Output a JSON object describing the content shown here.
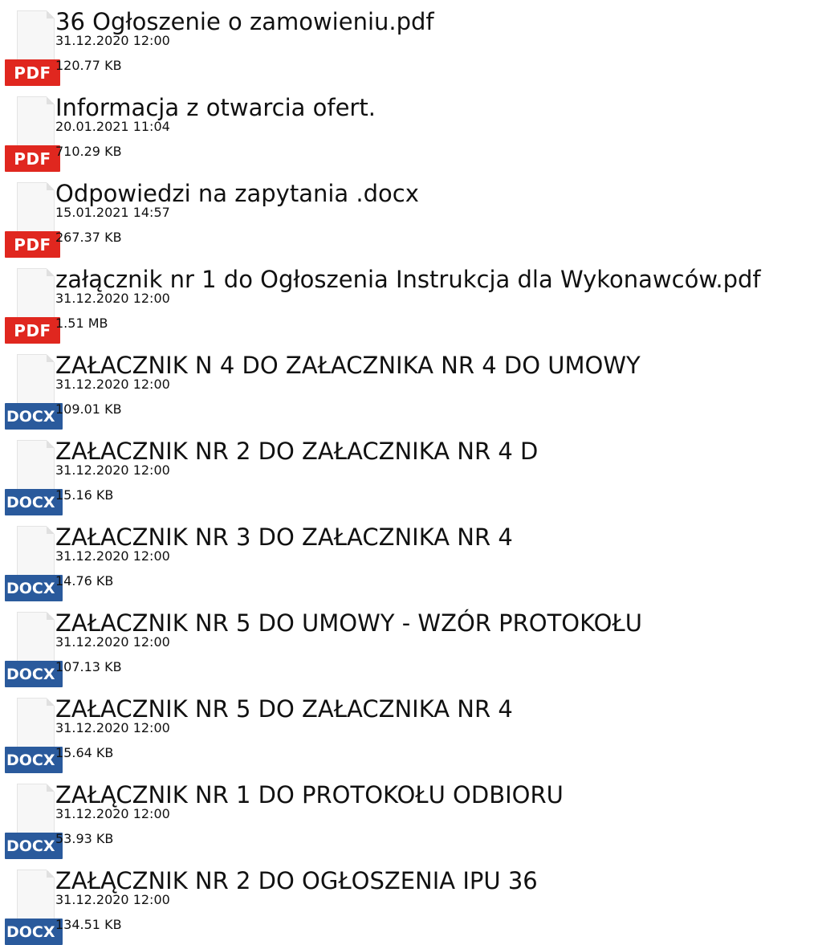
{
  "colors": {
    "pdf_badge": "#e0271f",
    "docx_badge": "#2a5a9c"
  },
  "files": [
    {
      "name": "36 Ogłoszenie o zamowieniu.pdf",
      "date": "31.12.2020 12:00",
      "size": "120.77 KB",
      "type": "PDF",
      "icon": "pdf-file-icon"
    },
    {
      "name": "Informacja z otwarcia ofert.",
      "date": "20.01.2021 11:04",
      "size": "710.29 KB",
      "type": "PDF",
      "icon": "pdf-file-icon"
    },
    {
      "name": "Odpowiedzi na zapytania .docx",
      "date": "15.01.2021 14:57",
      "size": "267.37 KB",
      "type": "PDF",
      "icon": "pdf-file-icon"
    },
    {
      "name": "załącznik nr 1 do Ogłoszenia Instrukcja dla Wykonawców.pdf",
      "date": "31.12.2020 12:00",
      "size": "1.51 MB",
      "type": "PDF",
      "icon": "pdf-file-icon"
    },
    {
      "name": "ZAŁACZNIK N 4 DO ZAŁACZNIKA NR 4 DO UMOWY",
      "date": "31.12.2020 12:00",
      "size": "109.01 KB",
      "type": "DOCX",
      "icon": "docx-file-icon"
    },
    {
      "name": "ZAŁACZNIK NR 2 DO ZAŁACZNIKA NR 4 D",
      "date": "31.12.2020 12:00",
      "size": "15.16 KB",
      "type": "DOCX",
      "icon": "docx-file-icon"
    },
    {
      "name": "ZAŁACZNIK NR 3 DO ZAŁACZNIKA NR 4",
      "date": "31.12.2020 12:00",
      "size": "14.76 KB",
      "type": "DOCX",
      "icon": "docx-file-icon"
    },
    {
      "name": "ZAŁACZNIK NR 5 DO UMOWY - WZÓR PROTOKOŁU",
      "date": "31.12.2020 12:00",
      "size": "107.13 KB",
      "type": "DOCX",
      "icon": "docx-file-icon"
    },
    {
      "name": "ZAŁACZNIK NR 5 DO ZAŁACZNIKA NR 4",
      "date": "31.12.2020 12:00",
      "size": "15.64 KB",
      "type": "DOCX",
      "icon": "docx-file-icon"
    },
    {
      "name": "ZAŁĄCZNIK NR 1 DO PROTOKOŁU ODBIORU",
      "date": "31.12.2020 12:00",
      "size": "53.93 KB",
      "type": "DOCX",
      "icon": "docx-file-icon"
    },
    {
      "name": "ZAŁĄCZNIK NR 2 DO OGŁOSZENIA IPU 36",
      "date": "31.12.2020 12:00",
      "size": "134.51 KB",
      "type": "DOCX",
      "icon": "docx-file-icon"
    }
  ]
}
